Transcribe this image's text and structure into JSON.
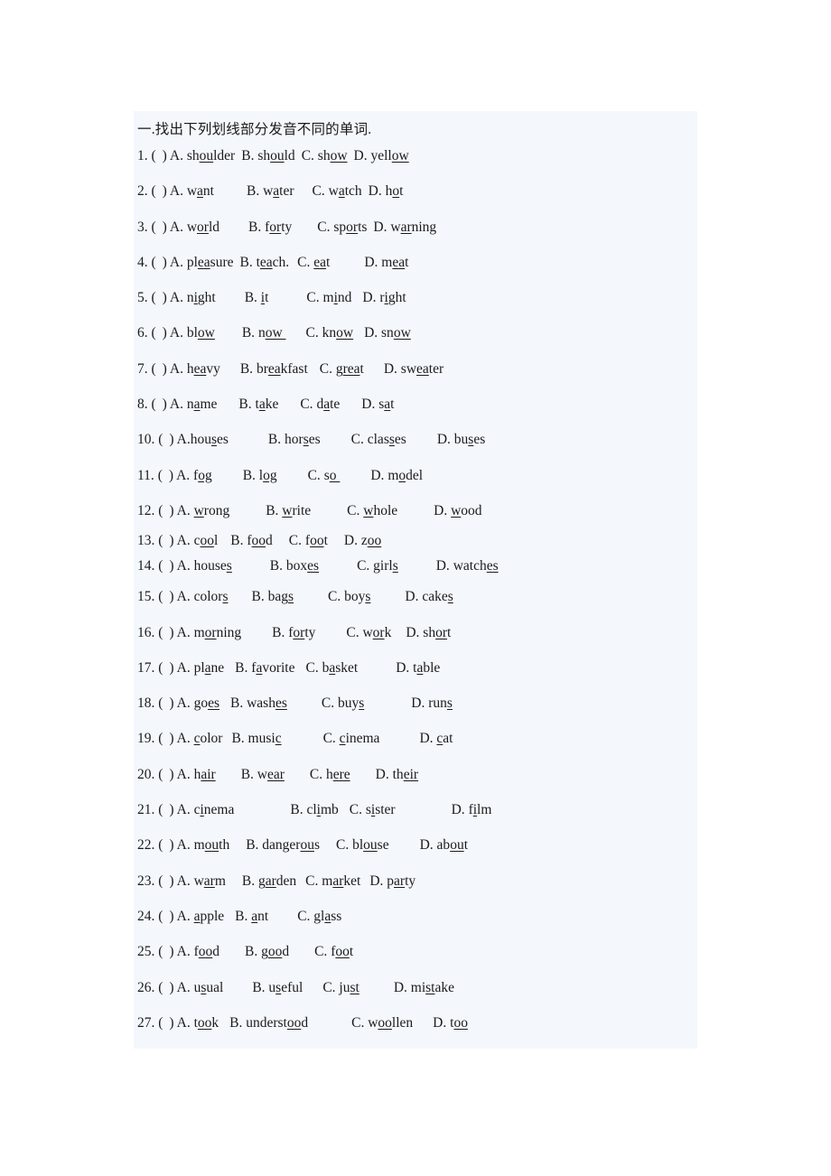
{
  "document": {
    "heading": "一.找出下列划线部分发音不同的单词.",
    "marker_open": "(",
    "marker_close": ")",
    "questions": [
      {
        "number": "1.",
        "options": [
          {
            "letter": "A.",
            "pre": "sh",
            "mark": "ou",
            "post": "lder",
            "gap": 7
          },
          {
            "letter": "B.",
            "pre": "sh",
            "mark": "ou",
            "post": "ld",
            "gap": 7
          },
          {
            "letter": "C.",
            "pre": "sh",
            "mark": "ow",
            "post": "",
            "gap": 7
          },
          {
            "letter": "D.",
            "pre": "yell",
            "mark": "ow",
            "post": "",
            "gap": 0
          }
        ]
      },
      {
        "number": "2.",
        "options": [
          {
            "letter": "A.",
            "pre": "w",
            "mark": "a",
            "post": "nt",
            "gap": 36
          },
          {
            "letter": "B.",
            "pre": "w",
            "mark": "a",
            "post": "ter",
            "gap": 20
          },
          {
            "letter": "C.",
            "pre": "w",
            "mark": "a",
            "post": "tch",
            "gap": 7
          },
          {
            "letter": "D.",
            "pre": "h",
            "mark": "o",
            "post": "t",
            "gap": 0
          }
        ]
      },
      {
        "number": "3.",
        "options": [
          {
            "letter": "A.",
            "pre": "w",
            "mark": "or",
            "post": "ld",
            "gap": 32
          },
          {
            "letter": "B.",
            "pre": "f",
            "mark": "or",
            "post": "ty",
            "gap": 28
          },
          {
            "letter": "C.",
            "pre": "sp",
            "mark": "or",
            "post": "ts",
            "gap": 7
          },
          {
            "letter": "D.",
            "pre": "w",
            "mark": "ar",
            "post": "ning",
            "gap": 0
          }
        ]
      },
      {
        "number": "4.",
        "options": [
          {
            "letter": "A.",
            "pre": "pl",
            "mark": "ea",
            "post": "sure",
            "gap": 7
          },
          {
            "letter": "B.",
            "pre": "t",
            "mark": "ea",
            "post": "ch.",
            "gap": 9
          },
          {
            "letter": "C.",
            "pre": "",
            "mark": "ea",
            "post": "t",
            "gap": 38
          },
          {
            "letter": "D.",
            "pre": "m",
            "mark": "ea",
            "post": "t",
            "gap": 0
          }
        ]
      },
      {
        "number": "5.",
        "options": [
          {
            "letter": "A.",
            "pre": "n",
            "mark": "i",
            "post": "ght",
            "gap": 32
          },
          {
            "letter": "B.",
            "pre": "",
            "mark": "i",
            "post": "t",
            "gap": 42
          },
          {
            "letter": "C.",
            "pre": "m",
            "mark": "i",
            "post": "nd",
            "gap": 12
          },
          {
            "letter": "D.",
            "pre": "r",
            "mark": "i",
            "post": "ght",
            "gap": 0
          }
        ]
      },
      {
        "number": "6.",
        "options": [
          {
            "letter": "A.",
            "pre": "bl",
            "mark": "ow",
            "post": "",
            "gap": 30
          },
          {
            "letter": "B.",
            "pre": "n",
            "mark": "ow ",
            "post": "",
            "gap": 22
          },
          {
            "letter": "C.",
            "pre": "kn",
            "mark": "ow",
            "post": "",
            "gap": 12
          },
          {
            "letter": "D.",
            "pre": "sn",
            "mark": "ow",
            "post": "",
            "gap": 0
          }
        ]
      },
      {
        "number": "7.",
        "options": [
          {
            "letter": "A.",
            "pre": "h",
            "mark": "ea",
            "post": "vy",
            "gap": 22
          },
          {
            "letter": "B.",
            "pre": "br",
            "mark": "ea",
            "post": "kfast",
            "gap": 13
          },
          {
            "letter": "C.",
            "pre": "g",
            "mark": "rea",
            "post": "t",
            "gap": 22
          },
          {
            "letter": "D.",
            "pre": "sw",
            "mark": "ea",
            "post": "ter",
            "gap": 0
          }
        ]
      },
      {
        "number": "8.",
        "options": [
          {
            "letter": "A.",
            "pre": "n",
            "mark": "a",
            "post": "me",
            "gap": 24
          },
          {
            "letter": "B.",
            "pre": "t",
            "mark": "a",
            "post": "ke",
            "gap": 24
          },
          {
            "letter": "C.",
            "pre": "d",
            "mark": "a",
            "post": "te",
            "gap": 24
          },
          {
            "letter": "D.",
            "pre": "s",
            "mark": "a",
            "post": "t",
            "gap": 0
          }
        ]
      },
      {
        "number": "10.",
        "options": [
          {
            "letter": "A.",
            "pre": "hou",
            "mark": "s",
            "post": "es",
            "gap": 44,
            "tight_letter": true
          },
          {
            "letter": "B.",
            "pre": "hor",
            "mark": "s",
            "post": "es",
            "gap": 34
          },
          {
            "letter": "C.",
            "pre": "clas",
            "mark": "s",
            "post": "es",
            "gap": 34
          },
          {
            "letter": "D.",
            "pre": "bu",
            "mark": "s",
            "post": "es",
            "gap": 0
          }
        ]
      },
      {
        "number": "11.",
        "options": [
          {
            "letter": "A.",
            "pre": "f",
            "mark": "og",
            "post": "",
            "gap": 34
          },
          {
            "letter": "B.",
            "pre": "l",
            "mark": "og",
            "post": "",
            "gap": 34
          },
          {
            "letter": "C.",
            "pre": "s",
            "mark": "o ",
            "post": "",
            "gap": 34
          },
          {
            "letter": "D.",
            "pre": "m",
            "mark": "o",
            "post": "del",
            "gap": 0
          }
        ]
      },
      {
        "number": "12.",
        "options": [
          {
            "letter": "A.",
            "pre": "",
            "mark": "w",
            "post": "rong",
            "gap": 40
          },
          {
            "letter": "B.",
            "pre": "",
            "mark": "w",
            "post": "rite",
            "gap": 40
          },
          {
            "letter": "C.",
            "pre": "",
            "mark": "w",
            "post": "hole",
            "gap": 40
          },
          {
            "letter": "D.",
            "pre": "",
            "mark": "w",
            "post": "ood",
            "gap": 0
          }
        ]
      },
      {
        "number": "13.",
        "options": [
          {
            "letter": "A.",
            "pre": "c",
            "mark": "oo",
            "post": "l",
            "gap": 14
          },
          {
            "letter": "B.",
            "pre": "f",
            "mark": "oo",
            "post": "d",
            "gap": 18
          },
          {
            "letter": "C.",
            "pre": "f",
            "mark": "oo",
            "post": "t",
            "gap": 18
          },
          {
            "letter": "D.",
            "pre": "z",
            "mark": "oo",
            "post": "",
            "gap": 0
          }
        ]
      },
      {
        "number": "14.",
        "options": [
          {
            "letter": "A.",
            "pre": "house",
            "mark": "s",
            "post": "",
            "gap": 42
          },
          {
            "letter": "B.",
            "pre": "box",
            "mark": "es",
            "post": "",
            "gap": 42
          },
          {
            "letter": "C.",
            "pre": "girl",
            "mark": "s",
            "post": "",
            "gap": 42
          },
          {
            "letter": "D.",
            "pre": "watch",
            "mark": "es",
            "post": "",
            "gap": 0
          }
        ]
      },
      {
        "number": "15.",
        "options": [
          {
            "letter": "A.",
            "pre": "color",
            "mark": "s",
            "post": "",
            "gap": 26
          },
          {
            "letter": "B.",
            "pre": "bag",
            "mark": "s",
            "post": "",
            "gap": 38
          },
          {
            "letter": "C.",
            "pre": "boy",
            "mark": "s",
            "post": "",
            "gap": 38
          },
          {
            "letter": "D.",
            "pre": "cake",
            "mark": "s",
            "post": "",
            "gap": 0
          }
        ]
      },
      {
        "number": "16.",
        "options": [
          {
            "letter": "A.",
            "pre": "m",
            "mark": "or",
            "post": "ning",
            "gap": 34
          },
          {
            "letter": "B.",
            "pre": "f",
            "mark": "or",
            "post": "ty",
            "gap": 34
          },
          {
            "letter": "C.",
            "pre": "w",
            "mark": "or",
            "post": "k",
            "gap": 16
          },
          {
            "letter": "D.",
            "pre": "sh",
            "mark": "or",
            "post": "t",
            "gap": 0
          }
        ]
      },
      {
        "number": "17.",
        "options": [
          {
            "letter": "A.",
            "pre": "pl",
            "mark": "a",
            "post": "ne",
            "gap": 12
          },
          {
            "letter": "B.",
            "pre": "f",
            "mark": "a",
            "post": "vorite",
            "gap": 12
          },
          {
            "letter": "C.",
            "pre": "b",
            "mark": "a",
            "post": "sket",
            "gap": 42
          },
          {
            "letter": "D.",
            "pre": "t",
            "mark": "a",
            "post": "ble",
            "gap": 0
          }
        ]
      },
      {
        "number": "18.",
        "options": [
          {
            "letter": "A.",
            "pre": "go",
            "mark": "es",
            "post": "",
            "gap": 12
          },
          {
            "letter": "B.",
            "pre": "wash",
            "mark": "es",
            "post": "",
            "gap": 38
          },
          {
            "letter": "C.",
            "pre": "buy",
            "mark": "s",
            "post": "",
            "gap": 52
          },
          {
            "letter": "D.",
            "pre": "run",
            "mark": "s",
            "post": "",
            "gap": 0
          }
        ]
      },
      {
        "number": "19.",
        "options": [
          {
            "letter": "A.",
            "pre": "",
            "mark": "c",
            "post": "olor",
            "gap": 10
          },
          {
            "letter": "B.",
            "pre": "musi",
            "mark": "c",
            "post": "",
            "gap": 46
          },
          {
            "letter": "C.",
            "pre": "",
            "mark": "c",
            "post": "inema",
            "gap": 44
          },
          {
            "letter": "D.",
            "pre": "",
            "mark": "c",
            "post": "at",
            "gap": 0
          }
        ]
      },
      {
        "number": "20.",
        "options": [
          {
            "letter": "A.",
            "pre": "h",
            "mark": "air",
            "post": "",
            "gap": 28
          },
          {
            "letter": "B.",
            "pre": "w",
            "mark": "ear",
            "post": "",
            "gap": 28
          },
          {
            "letter": "C.",
            "pre": "h",
            "mark": "ere",
            "post": "",
            "gap": 28
          },
          {
            "letter": "D.",
            "pre": "th",
            "mark": "eir",
            "post": "",
            "gap": 0
          }
        ]
      },
      {
        "number": "21.",
        "options": [
          {
            "letter": "A.",
            "pre": "c",
            "mark": "i",
            "post": "nema",
            "gap": 62
          },
          {
            "letter": "B.",
            "pre": "cl",
            "mark": "i",
            "post": "mb",
            "gap": 12
          },
          {
            "letter": "C.",
            "pre": "s",
            "mark": "i",
            "post": "ster",
            "gap": 62
          },
          {
            "letter": "D.",
            "pre": "f",
            "mark": "i",
            "post": "lm",
            "gap": 0
          }
        ]
      },
      {
        "number": "22.",
        "options": [
          {
            "letter": "A.",
            "pre": "m",
            "mark": "ou",
            "post": "th",
            "gap": 18
          },
          {
            "letter": "B.",
            "pre": "danger",
            "mark": "ou",
            "post": "s",
            "gap": 18
          },
          {
            "letter": "C.",
            "pre": "bl",
            "mark": "ou",
            "post": "se",
            "gap": 34
          },
          {
            "letter": "D.",
            "pre": "ab",
            "mark": "ou",
            "post": "t",
            "gap": 0
          }
        ]
      },
      {
        "number": "23.",
        "options": [
          {
            "letter": "A.",
            "pre": "w",
            "mark": "ar",
            "post": "m",
            "gap": 18
          },
          {
            "letter": "B.",
            "pre": "g",
            "mark": "ar",
            "post": "den",
            "gap": 10
          },
          {
            "letter": "C.",
            "pre": "m",
            "mark": "ar",
            "post": "ket",
            "gap": 10
          },
          {
            "letter": "D.",
            "pre": "p",
            "mark": "ar",
            "post": "ty",
            "gap": 0
          }
        ]
      },
      {
        "number": "24.",
        "options": [
          {
            "letter": "A.",
            "pre": "",
            "mark": " a",
            "post": "pple",
            "gap": 12
          },
          {
            "letter": "B.",
            "pre": "",
            "mark": "a",
            "post": "nt",
            "gap": 32
          },
          {
            "letter": "C.",
            "pre": "gl",
            "mark": "a",
            "post": "ss",
            "gap": 0
          }
        ]
      },
      {
        "number": "25.",
        "options": [
          {
            "letter": "A.",
            "pre": "f",
            "mark": "oo",
            "post": "d",
            "gap": 28
          },
          {
            "letter": "B.",
            "pre": "g",
            "mark": "oo",
            "post": "d",
            "gap": 28
          },
          {
            "letter": "C.",
            "pre": "f",
            "mark": "oo",
            "post": "t",
            "gap": 0
          }
        ]
      },
      {
        "number": "26.",
        "options": [
          {
            "letter": "A.",
            "pre": "u",
            "mark": "s",
            "post": "ual",
            "gap": 32
          },
          {
            "letter": "B.",
            "pre": "u",
            "mark": "s",
            "post": "eful",
            "gap": 22
          },
          {
            "letter": "C.",
            "pre": "ju",
            "mark": "st",
            "post": "",
            "gap": 38
          },
          {
            "letter": "D.",
            "pre": "mi",
            "mark": "st",
            "post": "ake",
            "gap": 0
          }
        ]
      },
      {
        "number": "27.",
        "options": [
          {
            "letter": "A.",
            "pre": "t",
            "mark": "oo",
            "post": "k",
            "gap": 12
          },
          {
            "letter": "B.",
            "pre": "underst",
            "mark": "oo",
            "post": "d",
            "gap": 48
          },
          {
            "letter": "C.",
            "pre": "w",
            "mark": "oo",
            "post": "llen",
            "gap": 22
          },
          {
            "letter": "D.",
            "pre": "t",
            "mark": "oo ",
            "post": "",
            "gap": 0
          }
        ]
      }
    ]
  },
  "colors": {
    "page_background": "#ffffff",
    "block_background": "#f4f7fc",
    "text": "#1b1b1b"
  }
}
